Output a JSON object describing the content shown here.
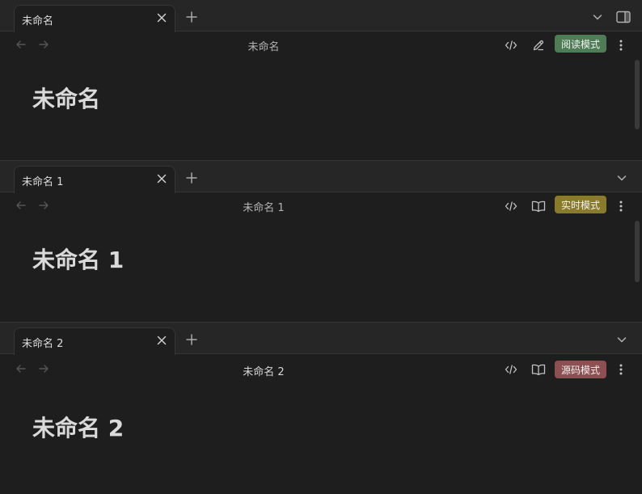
{
  "colors": {
    "background": "#1e1e1e",
    "tabbar": "#262626",
    "reading_mode": "#4e7d55",
    "live_mode": "#8a7a2c",
    "source_mode": "#8e4f52"
  },
  "panes": [
    {
      "tab_title": "未命名",
      "view_title": "未命名",
      "note_title": "未命名",
      "mode_label": "阅读模式",
      "mode_color": "reading_mode",
      "secondary_action_icon": "pencil-icon"
    },
    {
      "tab_title": "未命名 1",
      "view_title": "未命名 1",
      "note_title": "未命名 1",
      "mode_label": "实时模式",
      "mode_color": "live_mode",
      "secondary_action_icon": "book-open-icon"
    },
    {
      "tab_title": "未命名 2",
      "view_title": "未命名 2",
      "note_title": "未命名 2",
      "mode_label": "源码模式",
      "mode_color": "source_mode",
      "secondary_action_icon": "book-open-icon"
    }
  ]
}
